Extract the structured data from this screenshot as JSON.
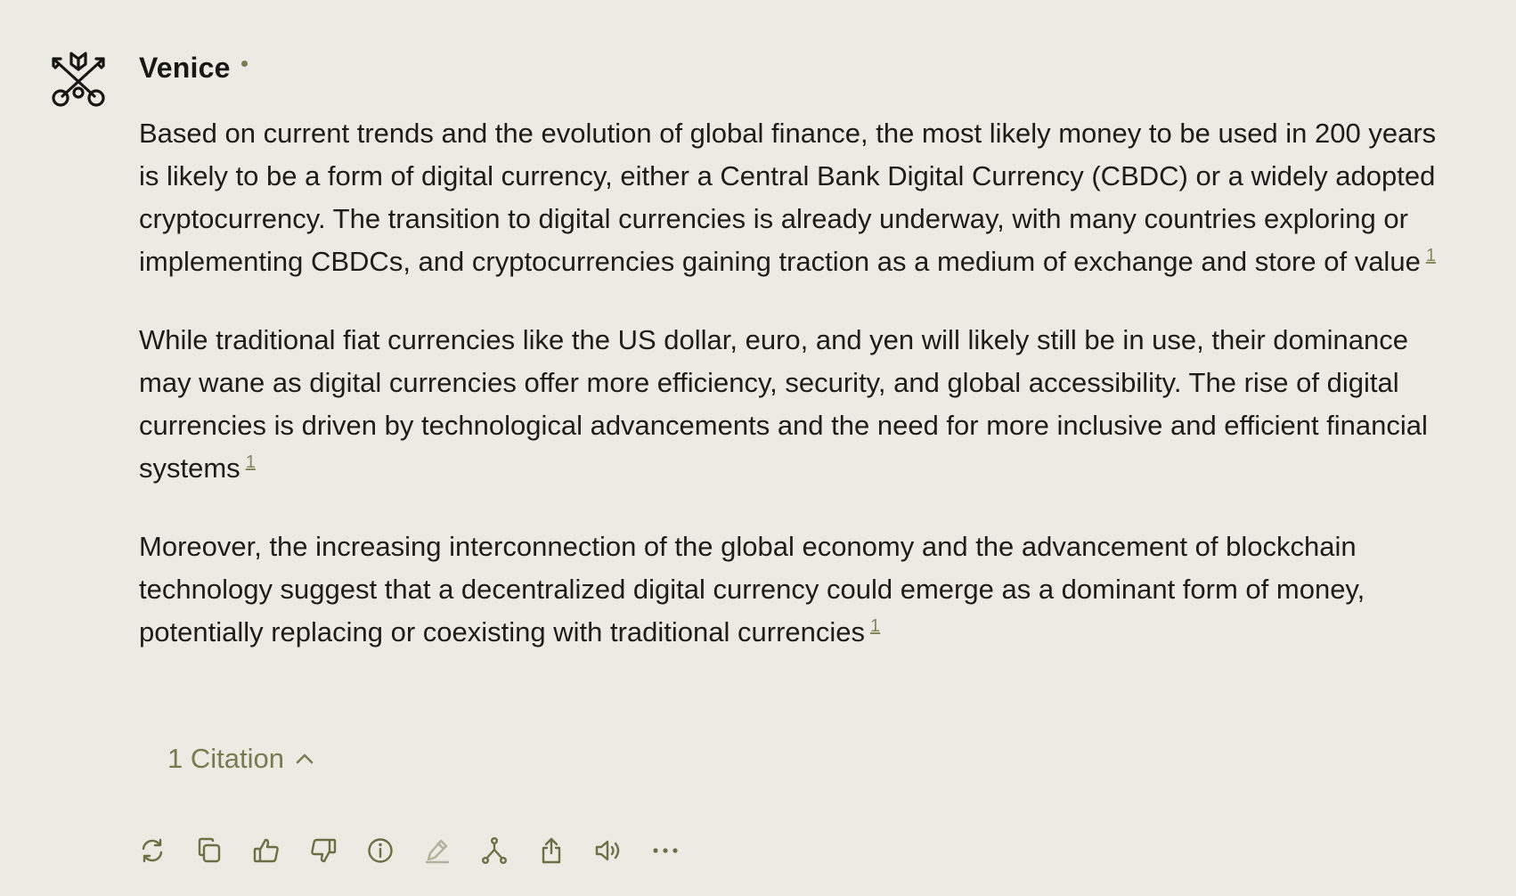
{
  "sender": {
    "name": "Venice",
    "status_color": "#7d7d55"
  },
  "message": {
    "paragraphs": [
      {
        "text": "Based on current trends and the evolution of global finance, the most likely money to be used in 200 years is likely to be a form of digital currency, either a Central Bank Digital Currency (CBDC) or a widely adopted cryptocurrency. The transition to digital currencies is already underway, with many countries exploring or implementing CBDCs, and cryptocurrencies gaining traction as a medium of exchange and store of value",
        "citation": "1"
      },
      {
        "text": "While traditional fiat currencies like the US dollar, euro, and yen will likely still be in use, their dominance may wane as digital currencies offer more efficiency, security, and global accessibility. The rise of digital currencies is driven by technological advancements and the need for more inclusive and efficient financial systems",
        "citation": "1"
      },
      {
        "text": "Moreover, the increasing interconnection of the global economy and the advancement of blockchain technology suggest that a decentralized digital currency could emerge as a dominant form of money, potentially replacing or coexisting with traditional currencies",
        "citation": "1"
      }
    ]
  },
  "citations": {
    "label": "1 Citation",
    "expanded": true,
    "icon": "chevron-up-icon"
  },
  "actions": [
    {
      "icon": "regenerate-icon",
      "name": "regenerate-button",
      "enabled": true
    },
    {
      "icon": "copy-icon",
      "name": "copy-button",
      "enabled": true
    },
    {
      "icon": "thumbs-up-icon",
      "name": "thumbs-up-button",
      "enabled": true
    },
    {
      "icon": "thumbs-down-icon",
      "name": "thumbs-down-button",
      "enabled": true
    },
    {
      "icon": "info-icon",
      "name": "info-button",
      "enabled": true
    },
    {
      "icon": "edit-icon",
      "name": "edit-button",
      "enabled": false
    },
    {
      "icon": "fork-icon",
      "name": "fork-button",
      "enabled": true
    },
    {
      "icon": "share-icon",
      "name": "share-button",
      "enabled": true
    },
    {
      "icon": "speaker-icon",
      "name": "read-aloud-button",
      "enabled": true
    },
    {
      "icon": "more-icon",
      "name": "more-options-button",
      "enabled": true
    }
  ],
  "colors": {
    "background": "#ecebe3",
    "text": "#1c1c1a",
    "accent": "#7a7a52",
    "icon": "#6e6e45"
  }
}
